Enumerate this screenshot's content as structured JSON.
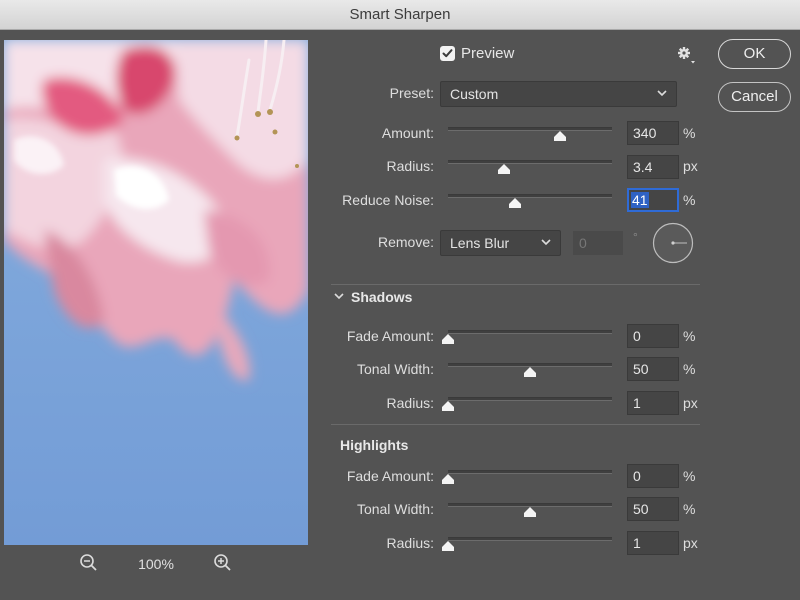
{
  "window": {
    "title": "Smart Sharpen"
  },
  "preview": {
    "label": "Preview",
    "checked": true,
    "zoom_level": "100%"
  },
  "buttons": {
    "ok": "OK",
    "cancel": "Cancel"
  },
  "preset": {
    "label": "Preset:",
    "value": "Custom"
  },
  "sharpen": {
    "amount": {
      "label": "Amount:",
      "value": "340",
      "unit": "%",
      "level": 0.68
    },
    "radius": {
      "label": "Radius:",
      "value": "3.4",
      "unit": "px",
      "level": 0.34
    },
    "reduce_noise": {
      "label": "Reduce Noise:",
      "value": "41",
      "unit": "%",
      "level": 0.41
    },
    "remove": {
      "label": "Remove:",
      "value": "Lens Blur",
      "angle_value": "0",
      "angle_unit": "°"
    }
  },
  "shadows": {
    "title": "Shadows",
    "fade_amount": {
      "label": "Fade Amount:",
      "value": "0",
      "unit": "%",
      "level": 0.0
    },
    "tonal_width": {
      "label": "Tonal Width:",
      "value": "50",
      "unit": "%",
      "level": 0.5
    },
    "radius": {
      "label": "Radius:",
      "value": "1",
      "unit": "px",
      "level": 0.0
    }
  },
  "highlights": {
    "title": "Highlights",
    "fade_amount": {
      "label": "Fade Amount:",
      "value": "0",
      "unit": "%",
      "level": 0.0
    },
    "tonal_width": {
      "label": "Tonal Width:",
      "value": "50",
      "unit": "%",
      "level": 0.5
    },
    "radius": {
      "label": "Radius:",
      "value": "1",
      "unit": "px",
      "level": 0.0
    }
  },
  "icons": {
    "zoom_out": "zoom-out-icon",
    "zoom_in": "zoom-in-icon",
    "settings": "gear-icon",
    "dropdown": "chevron-down-icon",
    "section_toggle": "chevron-down-icon",
    "angle_dial": "angle-dial-icon"
  },
  "colors": {
    "panel_bg": "#535353",
    "field_bg": "#454545",
    "focus_blue": "#2f6bd6",
    "preview_sky": "#7ea5da"
  }
}
